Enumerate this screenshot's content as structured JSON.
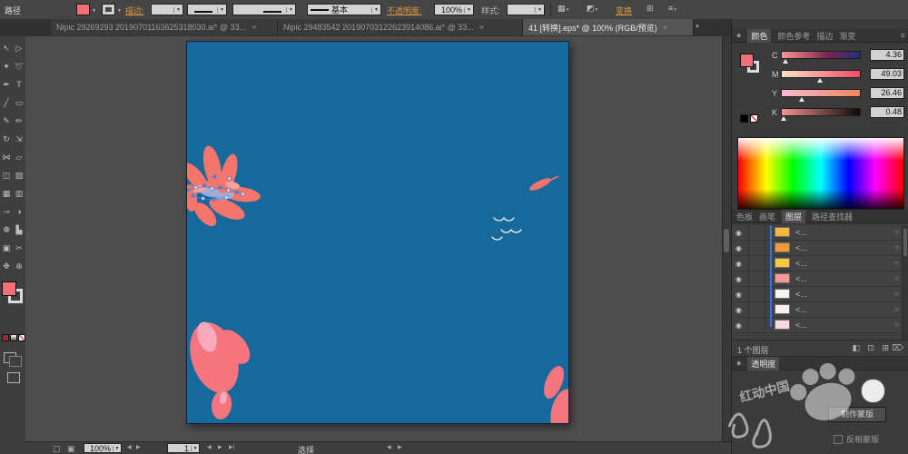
{
  "icons": {
    "dropdown": "▼",
    "eye": "◉",
    "target": "○",
    "close": "×",
    "menu": "≡",
    "left": "◀",
    "right": "▶",
    "last": "▶|",
    "diamond": "◆",
    "page1": "▢",
    "page2": "▣"
  },
  "control_bar": {
    "object_type": "路径",
    "fill_color": "#ef7078",
    "stroke_label": "描边:",
    "brush_name": "基本",
    "opacity_label": "不透明度:",
    "opacity_value": "100%",
    "style_label": "样式:",
    "transform_label": "变换",
    "shape_icon": "▦",
    "align_icon": "◩",
    "align2_icon": "⊞"
  },
  "doc_tabs": [
    {
      "label": "Nipic 29269293 20190701163625318030.ai* @ 33..."
    },
    {
      "label": "Nipic 29483542 20190703122623914086.ai* @ 33..."
    },
    {
      "label": "41 [转换].eps* @ 100% (RGB/预览)"
    }
  ],
  "toolbar": {
    "fill_color": "#ef7078",
    "mode_color": "#8c3038",
    "tools": [
      {
        "name": "selection-tool",
        "glyph": "↖"
      },
      {
        "name": "direct-selection-tool",
        "glyph": "▷"
      },
      {
        "name": "magic-wand-tool",
        "glyph": "✦"
      },
      {
        "name": "lasso-tool",
        "glyph": "➰"
      },
      {
        "name": "pen-tool",
        "glyph": "✒"
      },
      {
        "name": "type-tool",
        "glyph": "T"
      },
      {
        "name": "line-segment-tool",
        "glyph": "╱"
      },
      {
        "name": "rectangle-tool",
        "glyph": "▭"
      },
      {
        "name": "paintbrush-tool",
        "glyph": "✎"
      },
      {
        "name": "pencil-tool",
        "glyph": "✏"
      },
      {
        "name": "rotate-tool",
        "glyph": "↻"
      },
      {
        "name": "scale-tool",
        "glyph": "⇲"
      },
      {
        "name": "width-tool",
        "glyph": "⋈"
      },
      {
        "name": "free-transform-tool",
        "glyph": "▱"
      },
      {
        "name": "shape-builder-tool",
        "glyph": "◫"
      },
      {
        "name": "perspective-grid-tool",
        "glyph": "▨"
      },
      {
        "name": "mesh-tool",
        "glyph": "▦"
      },
      {
        "name": "gradient-tool",
        "glyph": "▥"
      },
      {
        "name": "eyedropper-tool",
        "glyph": "⊸"
      },
      {
        "name": "blend-tool",
        "glyph": "◑"
      },
      {
        "name": "symbol-sprayer-tool",
        "glyph": "❁"
      },
      {
        "name": "column-graph-tool",
        "glyph": "▙"
      },
      {
        "name": "artboard-tool",
        "glyph": "▣"
      },
      {
        "name": "slice-tool",
        "glyph": "✂"
      },
      {
        "name": "hand-tool",
        "glyph": "✥"
      },
      {
        "name": "zoom-tool",
        "glyph": "⊕"
      }
    ]
  },
  "canvas": {
    "artboard_color": "#17699c",
    "petal_color": "#f4756b",
    "petal_pink": "#f4757e",
    "petal_light": "#f9a9bb",
    "selection_blue": "#4a7fd8"
  },
  "color_panel": {
    "tabs": [
      "颜色",
      "颜色参考",
      "描边",
      "渐变"
    ],
    "channels": [
      {
        "label": "C",
        "value": "4.36",
        "pos": "5%",
        "track": "linear-gradient(to right,#f9958d,#7a2450 60%,#20317c)"
      },
      {
        "label": "M",
        "value": "49.03",
        "pos": "49%",
        "track": "linear-gradient(to right,#f7e3c8,#ef4b66)"
      },
      {
        "label": "Y",
        "value": "26.46",
        "pos": "26%",
        "track": "linear-gradient(to right,#f6b9d2,#f0875a)"
      },
      {
        "label": "K",
        "value": "0.48",
        "pos": "2%",
        "track": "linear-gradient(to right,#f4928b,#0a0a0a)"
      }
    ]
  },
  "layers_panel": {
    "tabs": [
      "色板",
      "画笔",
      "图层",
      "路径查找器"
    ],
    "rows": [
      {
        "name": "<...",
        "thumb": "#f6b63f"
      },
      {
        "name": "<...",
        "thumb": "#f29a3a"
      },
      {
        "name": "<...",
        "thumb": "#f6c83f"
      },
      {
        "name": "<...",
        "thumb": "#f59898"
      },
      {
        "name": "<...",
        "thumb": "#f7f3ef"
      },
      {
        "name": "<...",
        "thumb": "#fbeef0"
      },
      {
        "name": "<...",
        "thumb": "#f8d9de"
      }
    ],
    "footer": "1 个图层"
  },
  "transparency_panel": {
    "title": "透明度",
    "make_mask": "制作蒙版",
    "invert_mask": "反相蒙版"
  },
  "status_bar": {
    "zoom": "100%",
    "artboard": "1",
    "tool": "选择"
  },
  "watermark": {
    "text": "红动中国"
  }
}
